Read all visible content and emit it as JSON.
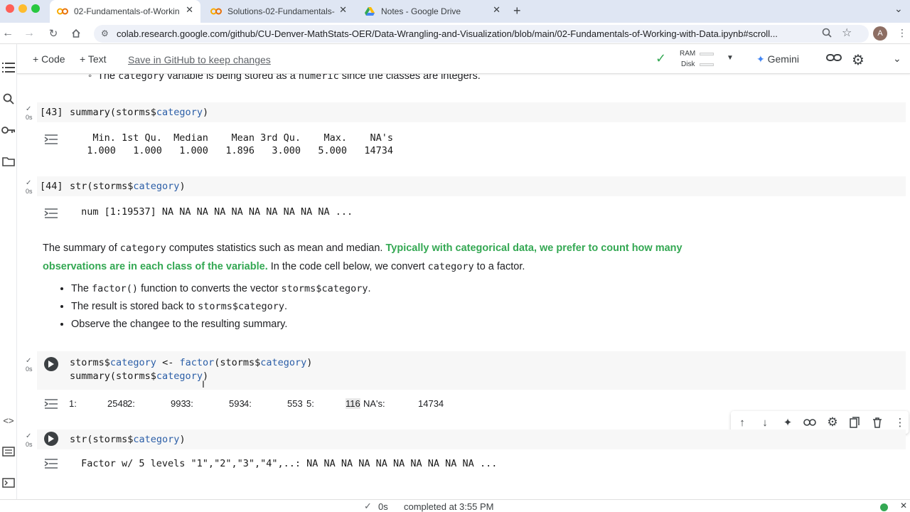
{
  "tabs": [
    {
      "label": "02-Fundamentals-of-Workin",
      "active": true
    },
    {
      "label": "Solutions-02-Fundamentals-",
      "active": false
    },
    {
      "label": "Notes - Google Drive",
      "active": false
    }
  ],
  "new_tab_label": "+",
  "url": "colab.research.google.com/github/CU-Denver-MathStats-OER/Data-Wrangling-and-Visualization/blob/main/02-Fundamentals-of-Working-with-Data.ipynb#scroll...",
  "profile_initial": "A",
  "toolbar": {
    "code_label": "+ Code",
    "text_label": "+ Text",
    "save_label": "Save in GitHub to keep changes",
    "ram_label": "RAM",
    "disk_label": "Disk",
    "gemini_label": "Gemini"
  },
  "partial_top": {
    "pre": "The ",
    "code1": "category",
    "mid": " variable is being stored as a ",
    "code2": "numeric",
    "post": " since the classes are integers."
  },
  "cells": {
    "c43": {
      "prompt": "[43]",
      "code_pre": "summary(storms$",
      "code_var": "category",
      "code_post": ")",
      "exec_time": "0s",
      "out_header": "   Min. 1st Qu.  Median    Mean 3rd Qu.    Max.    NA's ",
      "out_values": "  1.000   1.000   1.000   1.896   3.000   5.000   14734 "
    },
    "c44": {
      "prompt": "[44]",
      "code_pre": "str(storms$",
      "code_var": "category",
      "code_post": ")",
      "exec_time": "0s",
      "out": " num [1:19537] NA NA NA NA NA NA NA NA NA NA ..."
    },
    "c45": {
      "line1_pre": "storms$",
      "line1_var": "category",
      "line1_op": " <- ",
      "line1_fn": "factor",
      "line1_paren": "(storms$",
      "line1_var2": "category",
      "line1_end": ")",
      "line2_pre": "summary(storms$",
      "line2_var": "category",
      "line2_end": ")",
      "exec_time": "0s",
      "out": [
        {
          "label": "1:",
          "value": "2548"
        },
        {
          "label": "2:",
          "value": "993"
        },
        {
          "label": "3:",
          "value": "593"
        },
        {
          "label": "4:",
          "value": "553"
        },
        {
          "label": "5:",
          "value": "116"
        },
        {
          "label": "NA's:",
          "value": "14734"
        }
      ]
    },
    "c46": {
      "code_pre": "str(storms$",
      "code_var": "category",
      "code_post": ")",
      "exec_time": "0s",
      "out": " Factor w/ 5 levels \"1\",\"2\",\"3\",\"4\",..: NA NA NA NA NA NA NA NA NA NA ..."
    }
  },
  "markdown": {
    "p1_pre": "The summary of ",
    "p1_code": "category",
    "p1_mid": " computes statistics such as mean and median. ",
    "p1_hl1": "Typically with categorical data, we prefer to count how many",
    "p1_hl2": "observations are in each class of the variable.",
    "p1_post": " In the code cell below, we convert ",
    "p1_code2": "category",
    "p1_end": " to a factor.",
    "b1_pre": "The ",
    "b1_code": "factor()",
    "b1_mid": " function to converts the vector ",
    "b1_code2": "storms$category",
    "b1_end": ".",
    "b2_pre": "The result is stored back to ",
    "b2_code": "storms$category",
    "b2_end": ".",
    "b3": "Observe the changee to the resulting summary."
  },
  "status": {
    "time": "0s",
    "text": "completed at 3:55 PM"
  },
  "colors": {
    "accent_green": "#34a853",
    "code_blue": "#2b5ea7"
  }
}
